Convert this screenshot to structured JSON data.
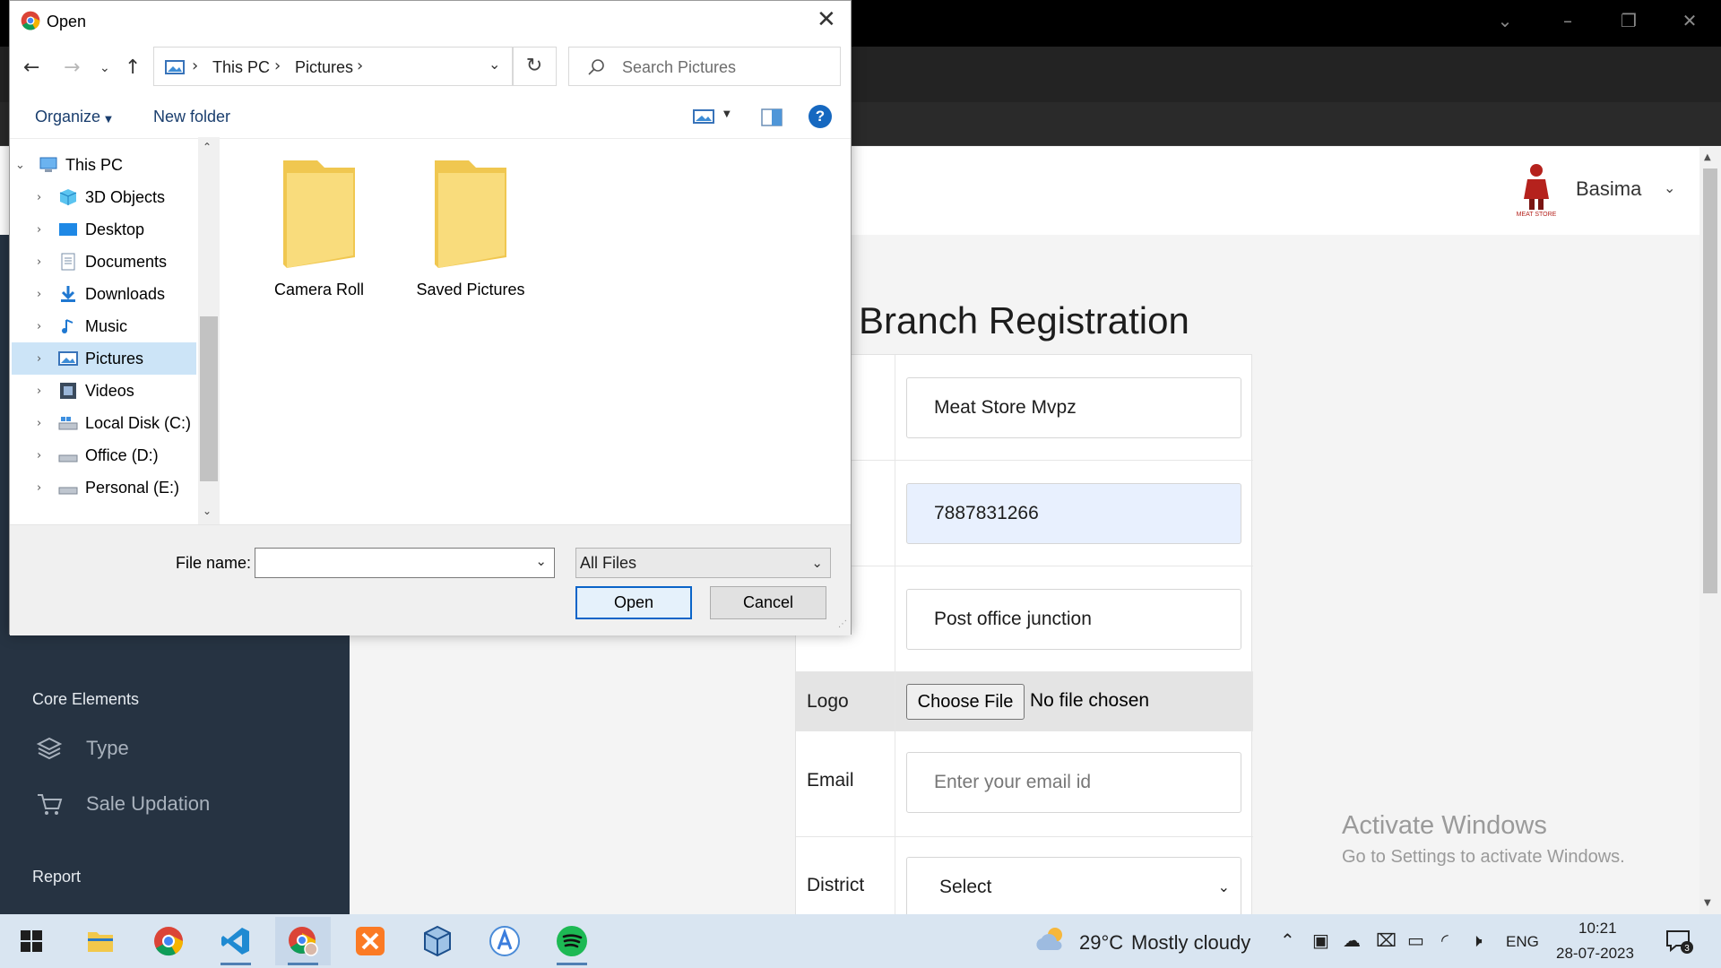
{
  "browser": {
    "caption_controls": [
      "⌄",
      "–",
      "❐",
      "✕"
    ],
    "toolbar_icons": [
      "share-icon",
      "star-icon",
      "extensions-icon",
      "side-panel-icon",
      "profile-avatar",
      "more-icon"
    ]
  },
  "header": {
    "brand_name": "MEAT STORE",
    "user_name": "Basima"
  },
  "sidebar": {
    "heading_core": "Core Elements",
    "items": [
      {
        "label": "Type",
        "icon": "layers-icon"
      },
      {
        "label": "Sale Updation",
        "icon": "cart-icon"
      }
    ],
    "heading_report": "Report"
  },
  "form": {
    "title": "Branch Registration",
    "rows": [
      {
        "label": "e",
        "value": "Meat Store Mvpz"
      },
      {
        "label": "act",
        "value": "7887831266"
      },
      {
        "label": "ess",
        "value": "Post office junction"
      }
    ],
    "logo_label": "Logo",
    "choose_file_label": "Choose File",
    "no_file_text": "No file chosen",
    "email_label": "Email",
    "email_placeholder": "Enter your email id",
    "district_label": "District",
    "district_value": "Select"
  },
  "watermark": {
    "title": "Activate Windows",
    "subtitle": "Go to Settings to activate Windows."
  },
  "dialog": {
    "title": "Open",
    "close_label": "✕",
    "breadcrumb": [
      "This PC",
      "Pictures"
    ],
    "search_placeholder": "Search Pictures",
    "organize_label": "Organize",
    "new_folder_label": "New folder",
    "help_label": "?",
    "tree": [
      {
        "label": "This PC",
        "icon": "computer-icon",
        "expanded": true
      },
      {
        "label": "3D Objects",
        "icon": "3d-objects-icon"
      },
      {
        "label": "Desktop",
        "icon": "desktop-icon"
      },
      {
        "label": "Documents",
        "icon": "documents-icon"
      },
      {
        "label": "Downloads",
        "icon": "downloads-icon"
      },
      {
        "label": "Music",
        "icon": "music-icon"
      },
      {
        "label": "Pictures",
        "icon": "pictures-icon",
        "selected": true
      },
      {
        "label": "Videos",
        "icon": "videos-icon"
      },
      {
        "label": "Local Disk (C:)",
        "icon": "drive-icon"
      },
      {
        "label": "Office (D:)",
        "icon": "drive-icon"
      },
      {
        "label": "Personal (E:)",
        "icon": "drive-icon"
      }
    ],
    "folders": [
      "Camera Roll",
      "Saved Pictures"
    ],
    "file_name_label": "File name:",
    "file_name_value": "",
    "file_type": "All Files",
    "open_label": "Open",
    "cancel_label": "Cancel"
  },
  "taskbar": {
    "apps": [
      "start-icon",
      "file-explorer-icon",
      "chrome-icon",
      "vscode-icon",
      "chrome-profile-icon",
      "xampp-icon",
      "virtualbox-icon",
      "android-studio-icon",
      "spotify-icon"
    ],
    "weather_temp": "29°C",
    "weather_text": "Mostly cloudy",
    "language": "ENG",
    "time": "10:21",
    "date": "28-07-2023",
    "notification_count": "3"
  },
  "colors": {
    "sidebar_bg": "#263342",
    "taskbar_bg": "#d9e5f1",
    "dialog_selected": "#cce4f7",
    "accent": "#0a64c8"
  }
}
